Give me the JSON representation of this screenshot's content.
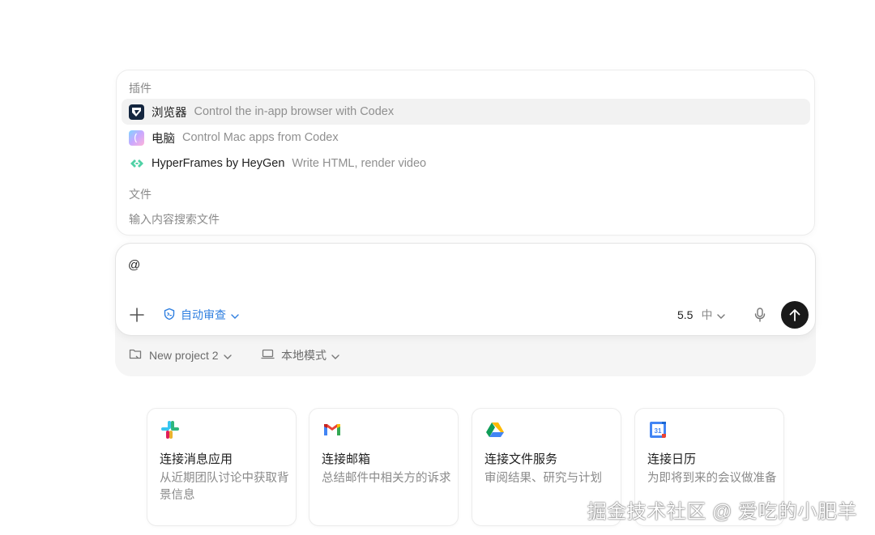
{
  "popup": {
    "plugins_title": "插件",
    "plugins": [
      {
        "name": "浏览器",
        "desc": "Control the in-app browser with Codex",
        "icon": "browser-icon"
      },
      {
        "name": "电脑",
        "desc": "Control Mac apps from Codex",
        "icon": "computer-icon"
      },
      {
        "name": "HyperFrames by HeyGen",
        "desc": "Write HTML, render video",
        "icon": "hyperframes-icon"
      }
    ],
    "files_title": "文件",
    "files_hint": "输入内容搜索文件"
  },
  "composer": {
    "text": "@",
    "review_label": "自动审查",
    "model": "5.5",
    "effort": "中"
  },
  "bottom_bar": {
    "project": "New project 2",
    "mode": "本地模式"
  },
  "cards": [
    {
      "title": "连接消息应用",
      "desc": "从近期团队讨论中获取背景信息",
      "icon": "slack-icon"
    },
    {
      "title": "连接邮箱",
      "desc": "总结邮件中相关方的诉求",
      "icon": "gmail-icon"
    },
    {
      "title": "连接文件服务",
      "desc": "审阅结果、研究与计划",
      "icon": "google-drive-icon"
    },
    {
      "title": "连接日历",
      "desc": "为即将到来的会议做准备",
      "icon": "google-calendar-icon"
    }
  ],
  "calendar_day": "31",
  "watermark": "掘金技术社区 @ 爱吃的小肥羊",
  "colors": {
    "accent": "#2f7fe0",
    "send": "#1a1a1a"
  }
}
